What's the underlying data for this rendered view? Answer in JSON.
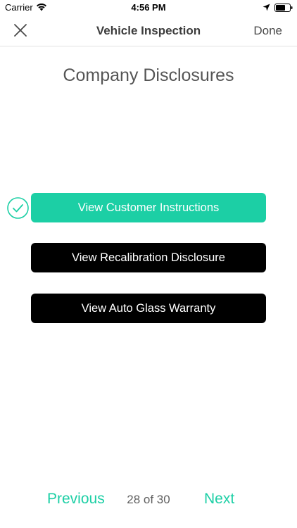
{
  "status_bar": {
    "carrier": "Carrier",
    "time": "4:56 PM",
    "icons": [
      "wifi-icon",
      "location-arrow-icon",
      "battery-icon"
    ]
  },
  "nav": {
    "close_icon": "close-icon",
    "title": "Vehicle Inspection",
    "done_label": "Done"
  },
  "page": {
    "title": "Company Disclosures"
  },
  "disclosures": [
    {
      "label": "View Customer Instructions",
      "viewed": true,
      "color": "#1ccfa5"
    },
    {
      "label": "View Recalibration Disclosure",
      "viewed": false,
      "color": "#000000"
    },
    {
      "label": "View Auto Glass Warranty",
      "viewed": false,
      "color": "#000000"
    }
  ],
  "pager": {
    "previous_label": "Previous",
    "page_indicator": "28 of 30",
    "next_label": "Next",
    "accent_color": "#1ccfa5"
  }
}
